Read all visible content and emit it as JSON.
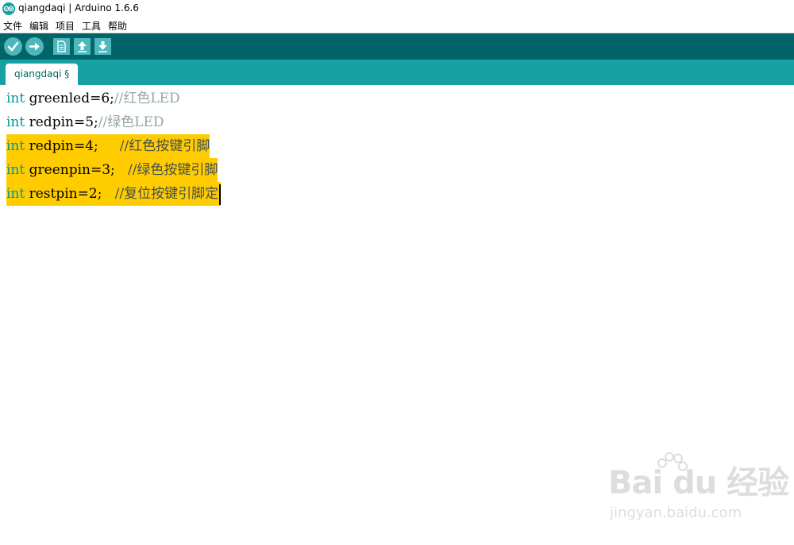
{
  "window": {
    "title": "qiangdaqi | Arduino 1.6.6",
    "icon": "arduino-logo-icon"
  },
  "menu": {
    "items": [
      {
        "label": "文件"
      },
      {
        "label": "编辑"
      },
      {
        "label": "项目"
      },
      {
        "label": "工具"
      },
      {
        "label": "帮助"
      }
    ]
  },
  "toolbar": {
    "buttons": [
      {
        "name": "verify",
        "icon": "checkmark-icon"
      },
      {
        "name": "upload",
        "icon": "arrow-right-icon"
      },
      {
        "name": "new",
        "icon": "new-file-icon"
      },
      {
        "name": "open",
        "icon": "arrow-up-icon"
      },
      {
        "name": "save",
        "icon": "arrow-down-icon"
      }
    ]
  },
  "tabs": [
    {
      "label": "qiangdaqi §"
    }
  ],
  "code": {
    "lines": [
      {
        "kw": "int",
        "code": " greenled=6;",
        "comment": "//红色LED",
        "selected": false
      },
      {
        "kw": "int",
        "code": " redpin=5;",
        "comment": "//绿色LED",
        "selected": false
      },
      {
        "kw": "int",
        "code": " redpin=4;     ",
        "comment": "//红色按键引脚",
        "selected": true
      },
      {
        "kw": "int",
        "code": " greenpin=3;   ",
        "comment": "//绿色按键引脚",
        "selected": true
      },
      {
        "kw": "int",
        "code": " restpin=2;   ",
        "comment": "//复位按键引脚定",
        "selected": true
      }
    ]
  },
  "colors": {
    "toolbar_bg": "#006468",
    "tabbar_bg": "#17a1a5",
    "button_bg": "#4db7bb",
    "selection": "#ffcc00",
    "keyword": "#00979c"
  },
  "watermark": {
    "logo": "Bai du 经验",
    "url": "jingyan.baidu.com"
  }
}
